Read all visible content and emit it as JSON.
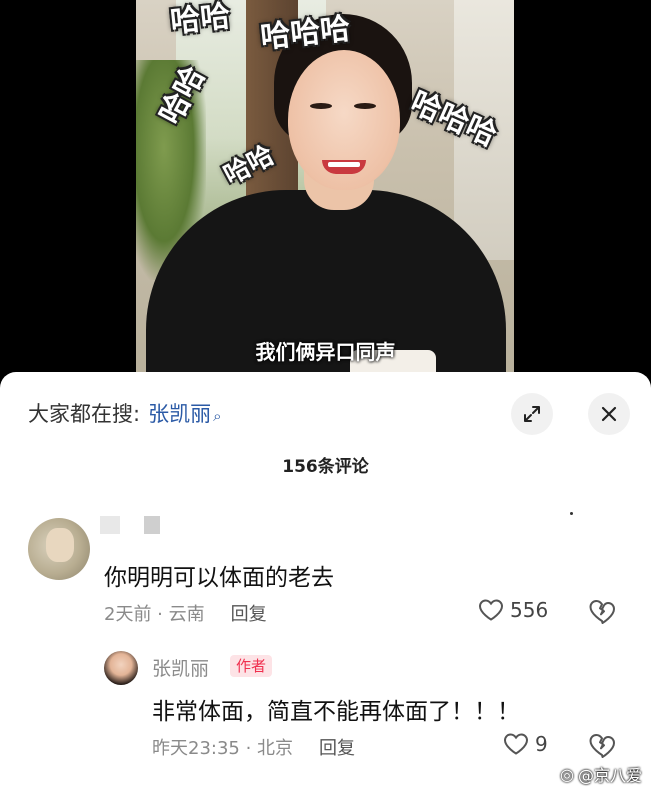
{
  "video": {
    "overlay_text": [
      "哈哈",
      "哈哈哈",
      "哈哈",
      "哈哈哈",
      "哈哈"
    ],
    "subtitle": "我们俩异口同声"
  },
  "sheet": {
    "search_prefix": "大家都在搜:",
    "search_term": "张凯丽",
    "comment_count": "156条评论",
    "expand_icon": "expand-icon",
    "close_icon": "close-icon"
  },
  "comments": [
    {
      "username": "",
      "text": "你明明可以体面的老去",
      "time_location": "2天前 · 云南",
      "reply_label": "回复",
      "likes": "556"
    },
    {
      "username": "张凯丽",
      "badge": "作者",
      "text": "非常体面，简直不能再体面了！！！",
      "time_location": "昨天23:35 · 北京",
      "reply_label": "回复",
      "likes": "9"
    }
  ],
  "watermark": "@京八爱",
  "colors": {
    "search_term": "#2b5aa6",
    "badge_bg": "#fde3e6",
    "badge_text": "#f0304f",
    "meta_gray": "#8a8a8a"
  }
}
